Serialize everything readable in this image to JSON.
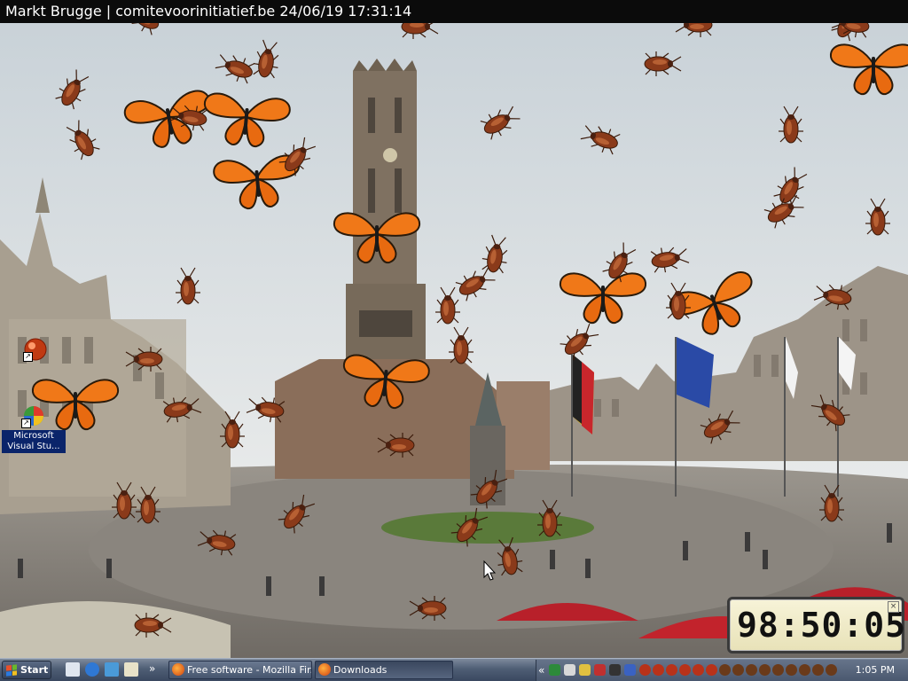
{
  "window": {
    "caption": "Markt Brugge | comitevoorinitiatief.be 24/06/19 17:31:14"
  },
  "desktop_icons": [
    {
      "name": "",
      "icon": "red-ball-shortcut-icon"
    },
    {
      "name": "Microsoft Visual Stu...",
      "icon": "visual-studio-icon"
    }
  ],
  "countdown": {
    "time": "98:50:05",
    "close": "×"
  },
  "taskbar": {
    "start_label": "Start",
    "overflow": "»",
    "tasks": [
      {
        "label": "Free software - Mozilla Fir...",
        "icon": "firefox-icon",
        "active": false
      },
      {
        "label": "Downloads",
        "icon": "downloads-icon",
        "active": true
      }
    ],
    "tray_chevron": "«",
    "clock": "1:05 PM"
  },
  "colors": {
    "butterfly": "#f07818",
    "cockroach": "#8a3a1a",
    "taskbar": "#4f5e75",
    "caption_bg": "#0b0b0b"
  }
}
